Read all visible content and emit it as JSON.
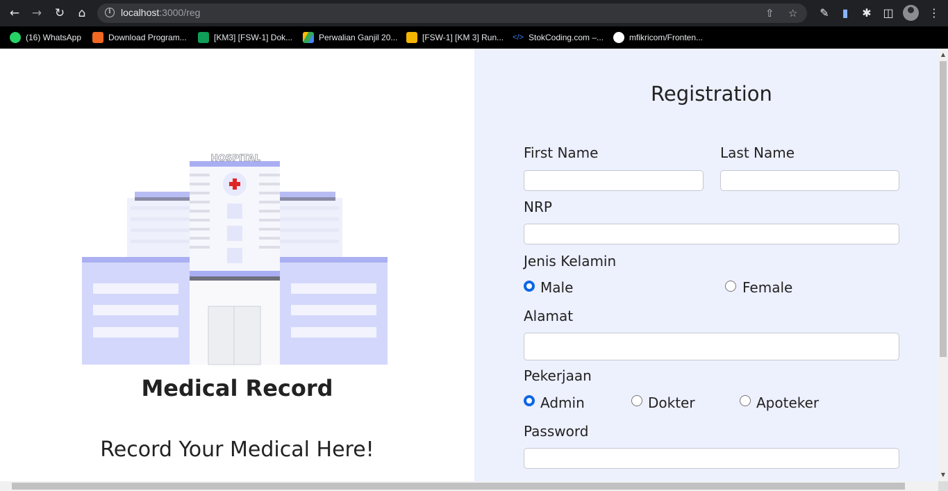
{
  "browser": {
    "url_host": "localhost",
    "url_path": ":3000/reg",
    "bookmarks": [
      {
        "label": "(16) WhatsApp",
        "color": "#25d366"
      },
      {
        "label": "Download Program...",
        "color": "#f26722"
      },
      {
        "label": "[KM3] [FSW-1] Dok...",
        "color": "#0f9d58"
      },
      {
        "label": "Perwalian Ganjil 20...",
        "color": "#fbbc04"
      },
      {
        "label": "[FSW-1] [KM 3] Run...",
        "color": "#f4b400"
      },
      {
        "label": "StokCoding.com –...",
        "color": "#3b82f6"
      },
      {
        "label": "mfikricom/Fronten...",
        "color": "#ffffff"
      }
    ]
  },
  "left": {
    "title": "Medical Record",
    "subtitle": "Record Your Medical Here!",
    "hospital_sign": "HOSPITAL"
  },
  "form": {
    "title": "Registration",
    "first_name_label": "First Name",
    "last_name_label": "Last Name",
    "nrp_label": "NRP",
    "gender_label": "Jenis Kelamin",
    "gender_options": [
      "Male",
      "Female"
    ],
    "gender_selected": "Male",
    "address_label": "Alamat",
    "job_label": "Pekerjaan",
    "job_options": [
      "Admin",
      "Dokter",
      "Apoteker"
    ],
    "job_selected": "Admin",
    "password_label": "Password"
  },
  "colors": {
    "accent": "#0b66e4",
    "panel": "#edf0fd",
    "building": "#d4d8fb"
  }
}
